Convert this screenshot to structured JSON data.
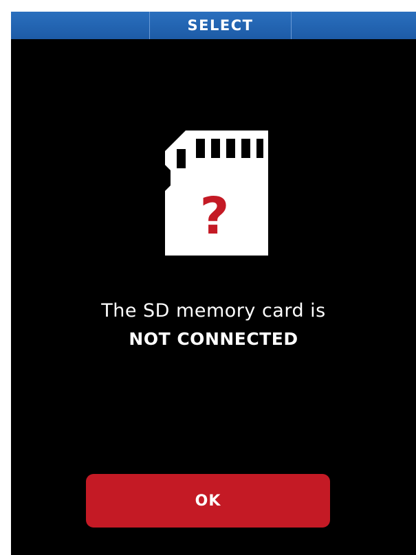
{
  "header": {
    "title": "SELECT"
  },
  "dialog": {
    "icon": "sd-card-question-icon",
    "icon_symbol": "?",
    "message_line1": "The SD memory card is",
    "message_line2": "NOT CONNECTED",
    "ok_label": "OK"
  },
  "colors": {
    "header_blue": "#2065b1",
    "background": "#000000",
    "button_red": "#c41a25",
    "icon_white": "#ffffff",
    "question_red": "#c41a25"
  }
}
